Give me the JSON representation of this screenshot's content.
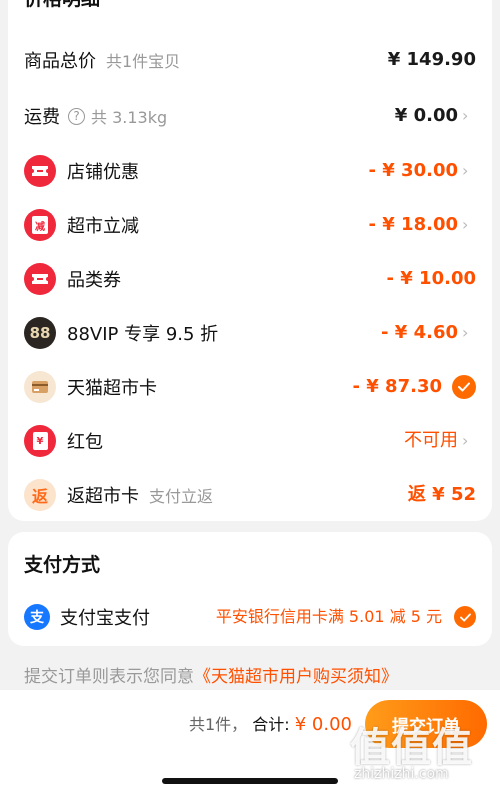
{
  "price_detail": {
    "title": "价格明细",
    "rows": [
      {
        "label": "商品总价",
        "sub": "共1件宝贝",
        "value": "¥ 149.90"
      },
      {
        "label": "运费",
        "sub": "共 3.13kg",
        "value": "¥ 0.00"
      },
      {
        "label": "店铺优惠",
        "value": "- ¥ 30.00",
        "icon": "coupon-icon"
      },
      {
        "label": "超市立减",
        "value": "- ¥ 18.00",
        "icon": "reduce-icon",
        "icon_text": "减"
      },
      {
        "label": "品类券",
        "value": "- ¥ 10.00",
        "icon": "coupon-icon"
      },
      {
        "label": "88VIP 专享 9.5 折",
        "value": "- ¥ 4.60",
        "icon": "vip-88-icon",
        "icon_text": "88"
      },
      {
        "label": "天猫超市卡",
        "value": "- ¥ 87.30",
        "icon": "card-icon"
      },
      {
        "label": "红包",
        "value": "不可用",
        "icon": "red-packet-icon",
        "icon_text": "¥"
      },
      {
        "label": "返超市卡",
        "sub": "支付立返",
        "value": "返 ¥ 52",
        "icon": "rebate-icon",
        "icon_text": "返"
      }
    ]
  },
  "payment": {
    "title": "支付方式",
    "method": "支付宝支付",
    "icon_text": "支",
    "promo": "平安银行信用卡满 5.01 减 5 元"
  },
  "notice": {
    "prefix": "提交订单则表示您同意",
    "link": "《天猫超市用户购买须知》"
  },
  "footer": {
    "count": "共1件，",
    "total_label": "合计:",
    "total": "¥ 0.00",
    "submit": "提交订单"
  },
  "watermark": {
    "text": "值值值",
    "url": "zhizhizhi.com"
  },
  "colors": {
    "accent": "#ff5000",
    "red_icon": "#f0283c",
    "check": "#ff6a00",
    "alipay": "#1677ff"
  }
}
